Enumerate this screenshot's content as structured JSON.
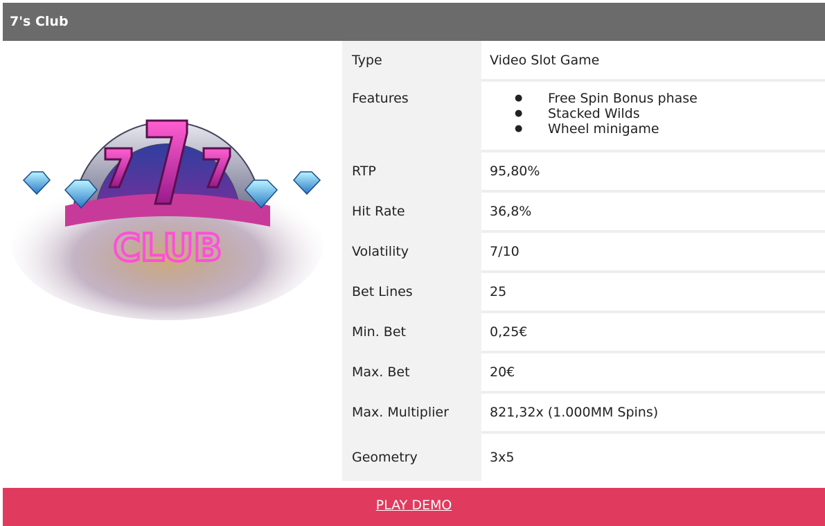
{
  "header": {
    "title": "7's Club"
  },
  "logo": {
    "text": "CLUB",
    "sevens": "777"
  },
  "specs": [
    {
      "label": "Type",
      "value": "Video Slot Game"
    },
    {
      "label": "Features",
      "items": [
        "Free Spin Bonus phase",
        "Stacked Wilds",
        "Wheel minigame"
      ]
    },
    {
      "label": "RTP",
      "value": "95,80%"
    },
    {
      "label": "Hit Rate",
      "value": "36,8%"
    },
    {
      "label": "Volatility",
      "value": "7/10"
    },
    {
      "label": "Bet Lines",
      "value": "25"
    },
    {
      "label": "Min. Bet",
      "value": "0,25€"
    },
    {
      "label": "Max. Bet",
      "value": "20€"
    },
    {
      "label": "Max. Multiplier",
      "value": "821,32x (1.000MM Spins)"
    },
    {
      "label": "Geometry",
      "value": "3x5"
    }
  ],
  "footer": {
    "cta_label": "PLAY DEMO"
  },
  "colors": {
    "header_bg": "#6b6b6b",
    "footer_bg": "#e03a5e",
    "label_bg": "#f2f2f2"
  }
}
